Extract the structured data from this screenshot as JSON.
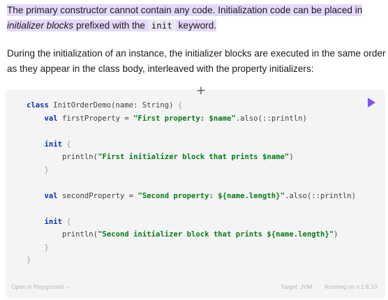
{
  "paragraph1": {
    "text_before": "The primary constructor cannot contain any code. Initialization code can be placed in ",
    "italic": "initializer blocks",
    "text_mid": " prefixed with the ",
    "code": "init",
    "text_after": " keyword."
  },
  "paragraph2": {
    "text": "During the initialization of an instance, the initializer blocks are executed in the same order as they appear in the class body, interleaved with the property initializers:"
  },
  "codeblock": {
    "expand_icon": "plus-icon",
    "run_icon": "play-icon",
    "lines": {
      "l1_kw": "class",
      "l1_rest": " InitOrderDemo(name: String) ",
      "l1_brace": "{",
      "l2_indent": "    ",
      "l2_kw": "val",
      "l2_mid": " firstProperty = ",
      "l2_str": "\"First property: $name\"",
      "l2_tail": ".also(::println)",
      "l4_indent": "    ",
      "l4_kw": "init",
      "l4_brace": " {",
      "l5_pre": "        println(",
      "l5_str": "\"First initializer block that prints $name\"",
      "l5_post": ")",
      "l6_indent": "    ",
      "l6_brace": "}",
      "l8_indent": "    ",
      "l8_kw": "val",
      "l8_mid": " secondProperty = ",
      "l8_str": "\"Second property: ${name.length}\"",
      "l8_tail": ".also(::println)",
      "l10_indent": "    ",
      "l10_kw": "init",
      "l10_brace": " {",
      "l11_pre": "        println(",
      "l11_str": "\"Second initializer block that prints ${name.length}\"",
      "l11_post": ")",
      "l12_indent": "    ",
      "l12_brace": "}",
      "l13_brace": "}"
    },
    "footer": {
      "open_playground": "Open in Playground →",
      "target": "Target: JVM",
      "running_on": "Running on v.1.8.10"
    }
  },
  "colors": {
    "highlight": "#e5d8fb",
    "keyword": "#0033b3",
    "string": "#067d17",
    "run_accent": "#7f52ff"
  }
}
